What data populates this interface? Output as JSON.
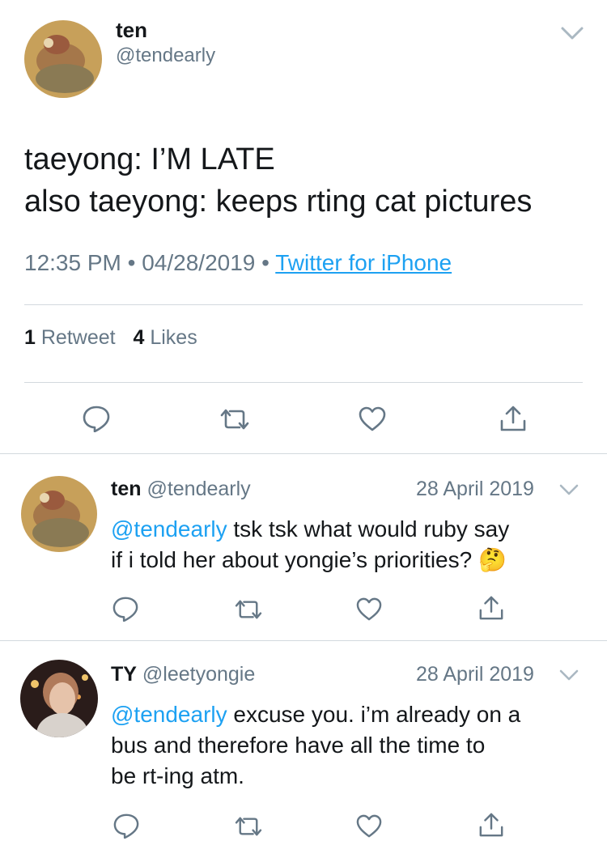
{
  "main_tweet": {
    "name": "ten",
    "handle": "@tendearly",
    "text_line1": "taeyong: I’M LATE",
    "text_line2": "also taeyong: keeps rting cat pictures",
    "time": "12:35 PM",
    "date": "04/28/2019",
    "separator": "•",
    "source": "Twitter for iPhone",
    "retweet_count": "1",
    "retweet_label": "Retweet",
    "like_count": "4",
    "like_label": "Likes"
  },
  "replies": [
    {
      "name": "ten",
      "handle": "@tendearly",
      "date": "28 April 2019",
      "mention": "@tendearly",
      "text_line1": " tsk tsk what would ruby say",
      "text_line2": "if i told her about yongie’s priorities?",
      "emoji": "🤔"
    },
    {
      "name": "TY",
      "handle": "@leetyongie",
      "date": "28 April 2019",
      "mention": "@tendearly",
      "text_line1": " excuse you. i’m already on a",
      "text_line2": "bus and therefore have all the time to",
      "text_line3": "be rt-ing atm."
    }
  ],
  "icons": [
    "reply-icon",
    "retweet-icon",
    "like-icon",
    "share-icon",
    "chevron-down-icon"
  ],
  "colors": {
    "link": "#1da1f2",
    "muted": "#657786",
    "text": "#14171a",
    "divider": "#d3d9de"
  }
}
